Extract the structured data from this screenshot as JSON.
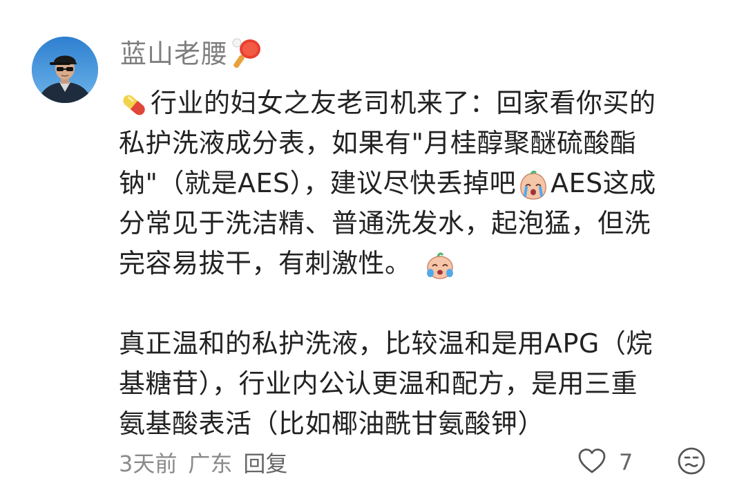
{
  "comment": {
    "username": "蓝山老腰",
    "paragraph1_lines": [
      "行业的妇女之友老司机来了：回家看你买的",
      "私护洗液成分表，如果有\"月桂醇聚醚硫酸酯",
      "钠\"（就是AES），建议尽快丢掉吧",
      "AES这成",
      "分常见于洗洁精、普通洗发水，起泡猛，但洗",
      "完容易拔干，有刺激性。"
    ],
    "paragraph2_lines": [
      "真正温和的私护洗液，比较温和是用APG（烷",
      "基糖苷），行业内公认更温和配方，是用三重",
      "氨基酸表活（比如椰油酰甘氨酸钾）"
    ],
    "time": "3天前",
    "location": "广东",
    "reply_label": "回复",
    "like_count": "7",
    "icons": {
      "username_badge": "ping-pong-paddle-icon",
      "leading": "pill-icon",
      "inline1": "crying-face-icon",
      "inline2": "crying-face-icon",
      "like": "heart-outline-icon",
      "dislike": "unamused-face-icon"
    }
  }
}
